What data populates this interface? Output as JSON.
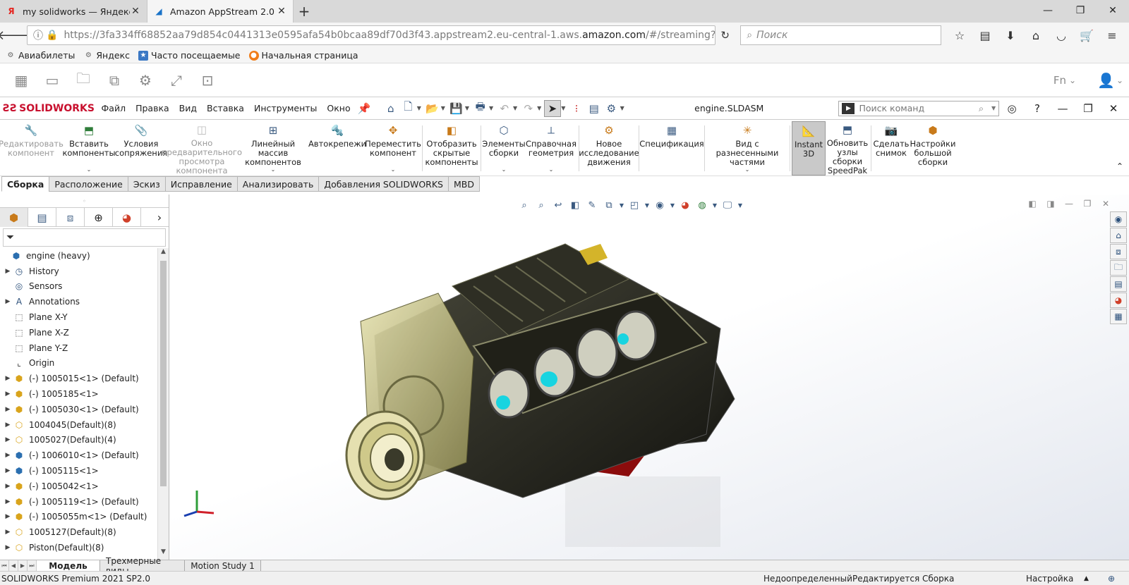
{
  "browser": {
    "tabs": [
      {
        "title": "my solidworks — Яндекс: на",
        "favicon": "Я",
        "active": false
      },
      {
        "title": "Amazon AppStream 2.0",
        "favicon": "◢",
        "active": true
      }
    ],
    "url_prefix": "https://3fa334ff68852aa79d854c0441313e0595afa54b0bcaa89df70d3f43.appstream2.eu-central-1.aws.",
    "url_domain": "amazon.com",
    "url_suffix": "/#/streaming?reference=flee",
    "search_placeholder": "Поиск",
    "bookmarks": [
      "Авиабилеты",
      "Яндекс",
      "Часто посещаемые",
      "Начальная страница"
    ]
  },
  "appstream": {
    "fn_label": "Fn"
  },
  "solidworks": {
    "logo_text": "SOLIDWORKS",
    "menu": [
      "Файл",
      "Правка",
      "Вид",
      "Вставка",
      "Инструменты",
      "Окно"
    ],
    "document_title": "engine.SLDASM",
    "command_search_placeholder": "Поиск команд",
    "ribbon": [
      {
        "label": "Редактировать компонент",
        "icon": "edit-component-icon",
        "disabled": true
      },
      {
        "label": "Вставить компоненты",
        "icon": "insert-components-icon",
        "dropdown": true
      },
      {
        "label": "Условия сопряжения",
        "icon": "mate-icon"
      },
      {
        "label": "Окно предварительного просмотра компонента",
        "icon": "preview-window-icon",
        "disabled": true
      },
      {
        "label": "Линейный массив компонентов",
        "icon": "linear-pattern-icon",
        "dropdown": true
      },
      {
        "label": "Автокрепежи",
        "icon": "smart-fasteners-icon"
      },
      {
        "label": "Переместить компонент",
        "icon": "move-component-icon",
        "dropdown": true
      },
      {
        "label": "Отобразить скрытые компоненты",
        "icon": "show-hidden-icon"
      },
      {
        "label": "Элементы сборки",
        "icon": "assembly-features-icon",
        "dropdown": true
      },
      {
        "label": "Справочная геометрия",
        "icon": "reference-geometry-icon",
        "dropdown": true
      },
      {
        "label": "Новое исследование движения",
        "icon": "motion-study-icon"
      },
      {
        "label": "Спецификация",
        "icon": "bom-icon"
      },
      {
        "label": "Вид с разнесенными частями",
        "icon": "exploded-view-icon",
        "dropdown": true
      },
      {
        "label": "Instant 3D",
        "icon": "instant3d-icon",
        "active": true
      },
      {
        "label": "Обновить узлы сборки SpeedPak",
        "icon": "speedpak-icon"
      },
      {
        "label": "Сделать снимок",
        "icon": "snapshot-icon"
      },
      {
        "label": "Настройки большой сборки",
        "icon": "large-assembly-icon"
      }
    ],
    "command_tabs": [
      "Сборка",
      "Расположение",
      "Эскиз",
      "Исправление",
      "Анализировать",
      "Добавления SOLIDWORKS",
      "MBD"
    ],
    "active_command_tab": "Сборка",
    "tree": [
      {
        "label": "engine  (heavy)",
        "icon": "assembly-icon",
        "expand": "",
        "indent": 0
      },
      {
        "label": "History",
        "icon": "history-icon",
        "expand": "▶",
        "indent": 1
      },
      {
        "label": "Sensors",
        "icon": "sensors-icon",
        "expand": "",
        "indent": 1
      },
      {
        "label": "Annotations",
        "icon": "annotations-icon",
        "expand": "▶",
        "indent": 1
      },
      {
        "label": "Plane X-Y",
        "icon": "plane-icon",
        "expand": "",
        "indent": 1
      },
      {
        "label": "Plane X-Z",
        "icon": "plane-icon",
        "expand": "",
        "indent": 1
      },
      {
        "label": "Plane Y-Z",
        "icon": "plane-icon",
        "expand": "",
        "indent": 1
      },
      {
        "label": "Origin",
        "icon": "origin-icon",
        "expand": "",
        "indent": 1
      },
      {
        "label": "(-) 1005015<1> (Default)",
        "icon": "subassembly-icon",
        "expand": "▶",
        "indent": 1
      },
      {
        "label": "(-) 1005185<1>",
        "icon": "subassembly-icon",
        "expand": "▶",
        "indent": 1
      },
      {
        "label": "(-) 1005030<1> (Default)",
        "icon": "subassembly-icon",
        "expand": "▶",
        "indent": 1
      },
      {
        "label": "1004045(Default)(8)",
        "icon": "pattern-icon",
        "expand": "▶",
        "indent": 1
      },
      {
        "label": "1005027(Default)(4)",
        "icon": "pattern-icon",
        "expand": "▶",
        "indent": 1
      },
      {
        "label": "(-) 1006010<1> (Default)",
        "icon": "assembly-icon",
        "expand": "▶",
        "indent": 1
      },
      {
        "label": "(-) 1005115<1>",
        "icon": "assembly-icon",
        "expand": "▶",
        "indent": 1
      },
      {
        "label": "(-) 1005042<1>",
        "icon": "subassembly-icon",
        "expand": "▶",
        "indent": 1
      },
      {
        "label": "(-) 1005119<1> (Default)",
        "icon": "subassembly-icon",
        "expand": "▶",
        "indent": 1
      },
      {
        "label": "(-) 1005055m<1> (Default)",
        "icon": "subassembly-icon",
        "expand": "▶",
        "indent": 1
      },
      {
        "label": "1005127(Default)(8)",
        "icon": "pattern-icon",
        "expand": "▶",
        "indent": 1
      },
      {
        "label": "Piston(Default)(8)",
        "icon": "pattern-icon",
        "expand": "▶",
        "indent": 1
      }
    ],
    "bottom_tabs": [
      "Модель",
      "Трехмерные виды",
      "Motion Study 1"
    ],
    "active_bottom_tab": "Модель",
    "status": {
      "product": "SOLIDWORKS Premium 2021 SP2.0",
      "state": "Недоопределенный",
      "mode": "Редактируется Сборка",
      "settings": "Настройка"
    },
    "colors": {
      "brand": "#c8102e",
      "accent": "#3a5a80",
      "bore": "#18d4e0"
    }
  }
}
